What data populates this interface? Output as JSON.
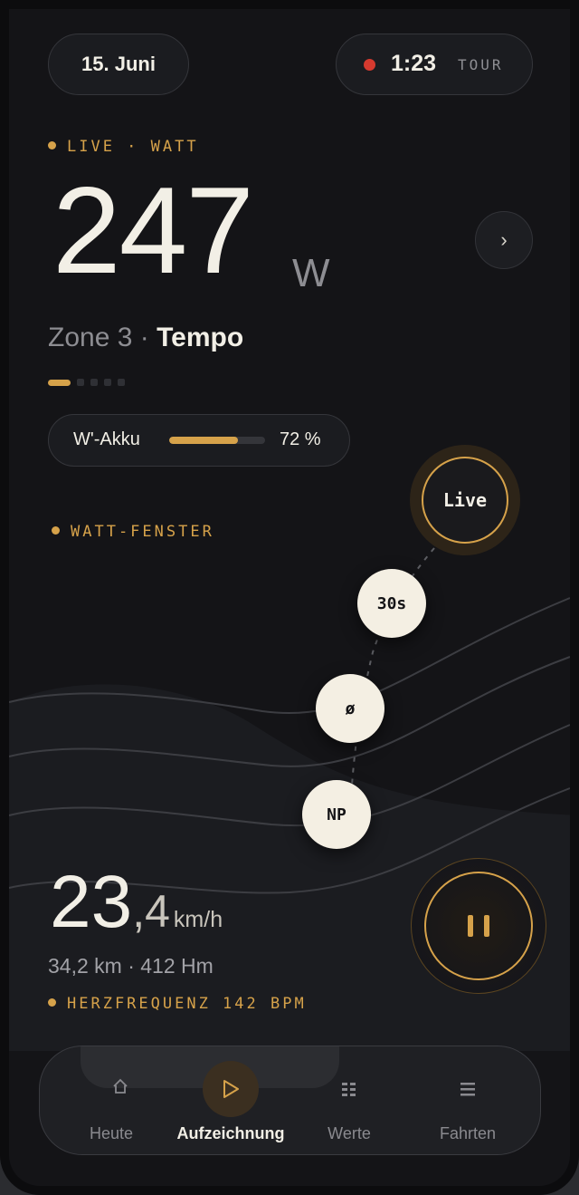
{
  "header": {
    "date": "15. Juni",
    "timer": {
      "value": "1:23",
      "label": "TOUR"
    }
  },
  "live": {
    "kicker": "LIVE · WATT",
    "watts": "247",
    "unit": "W",
    "zone_label": "Zone 3 ·",
    "zone_name": "Tempo",
    "zone_index": 1,
    "zone_count": 5,
    "chevron": "›"
  },
  "akku": {
    "label": "W'-Akku",
    "value": "72 %",
    "level": 0.72
  },
  "watt_window": {
    "kicker": "WATT-FENSTER",
    "options": [
      "Live",
      "30s",
      "ø",
      "NP"
    ],
    "selected": "Live"
  },
  "ride": {
    "speed_int": "23",
    "speed_dec": ",4",
    "speed_unit": "km/h",
    "distance_elevation": "34,2 km · 412 Hm",
    "heart_rate": "HERZFREQUENZ 142 BPM"
  },
  "nav": {
    "items": [
      {
        "label": "Heute",
        "icon": "home-icon"
      },
      {
        "label": "Aufzeichnung",
        "icon": "play-icon"
      },
      {
        "label": "Werte",
        "icon": "grid-icon"
      },
      {
        "label": "Fahrten",
        "icon": "list-icon"
      }
    ],
    "active": "Aufzeichnung"
  },
  "colors": {
    "background": "#141417",
    "accent": "#d6a24a",
    "text": "#f2efe6",
    "muted": "#8d8d92",
    "record": "#d63a2f"
  }
}
